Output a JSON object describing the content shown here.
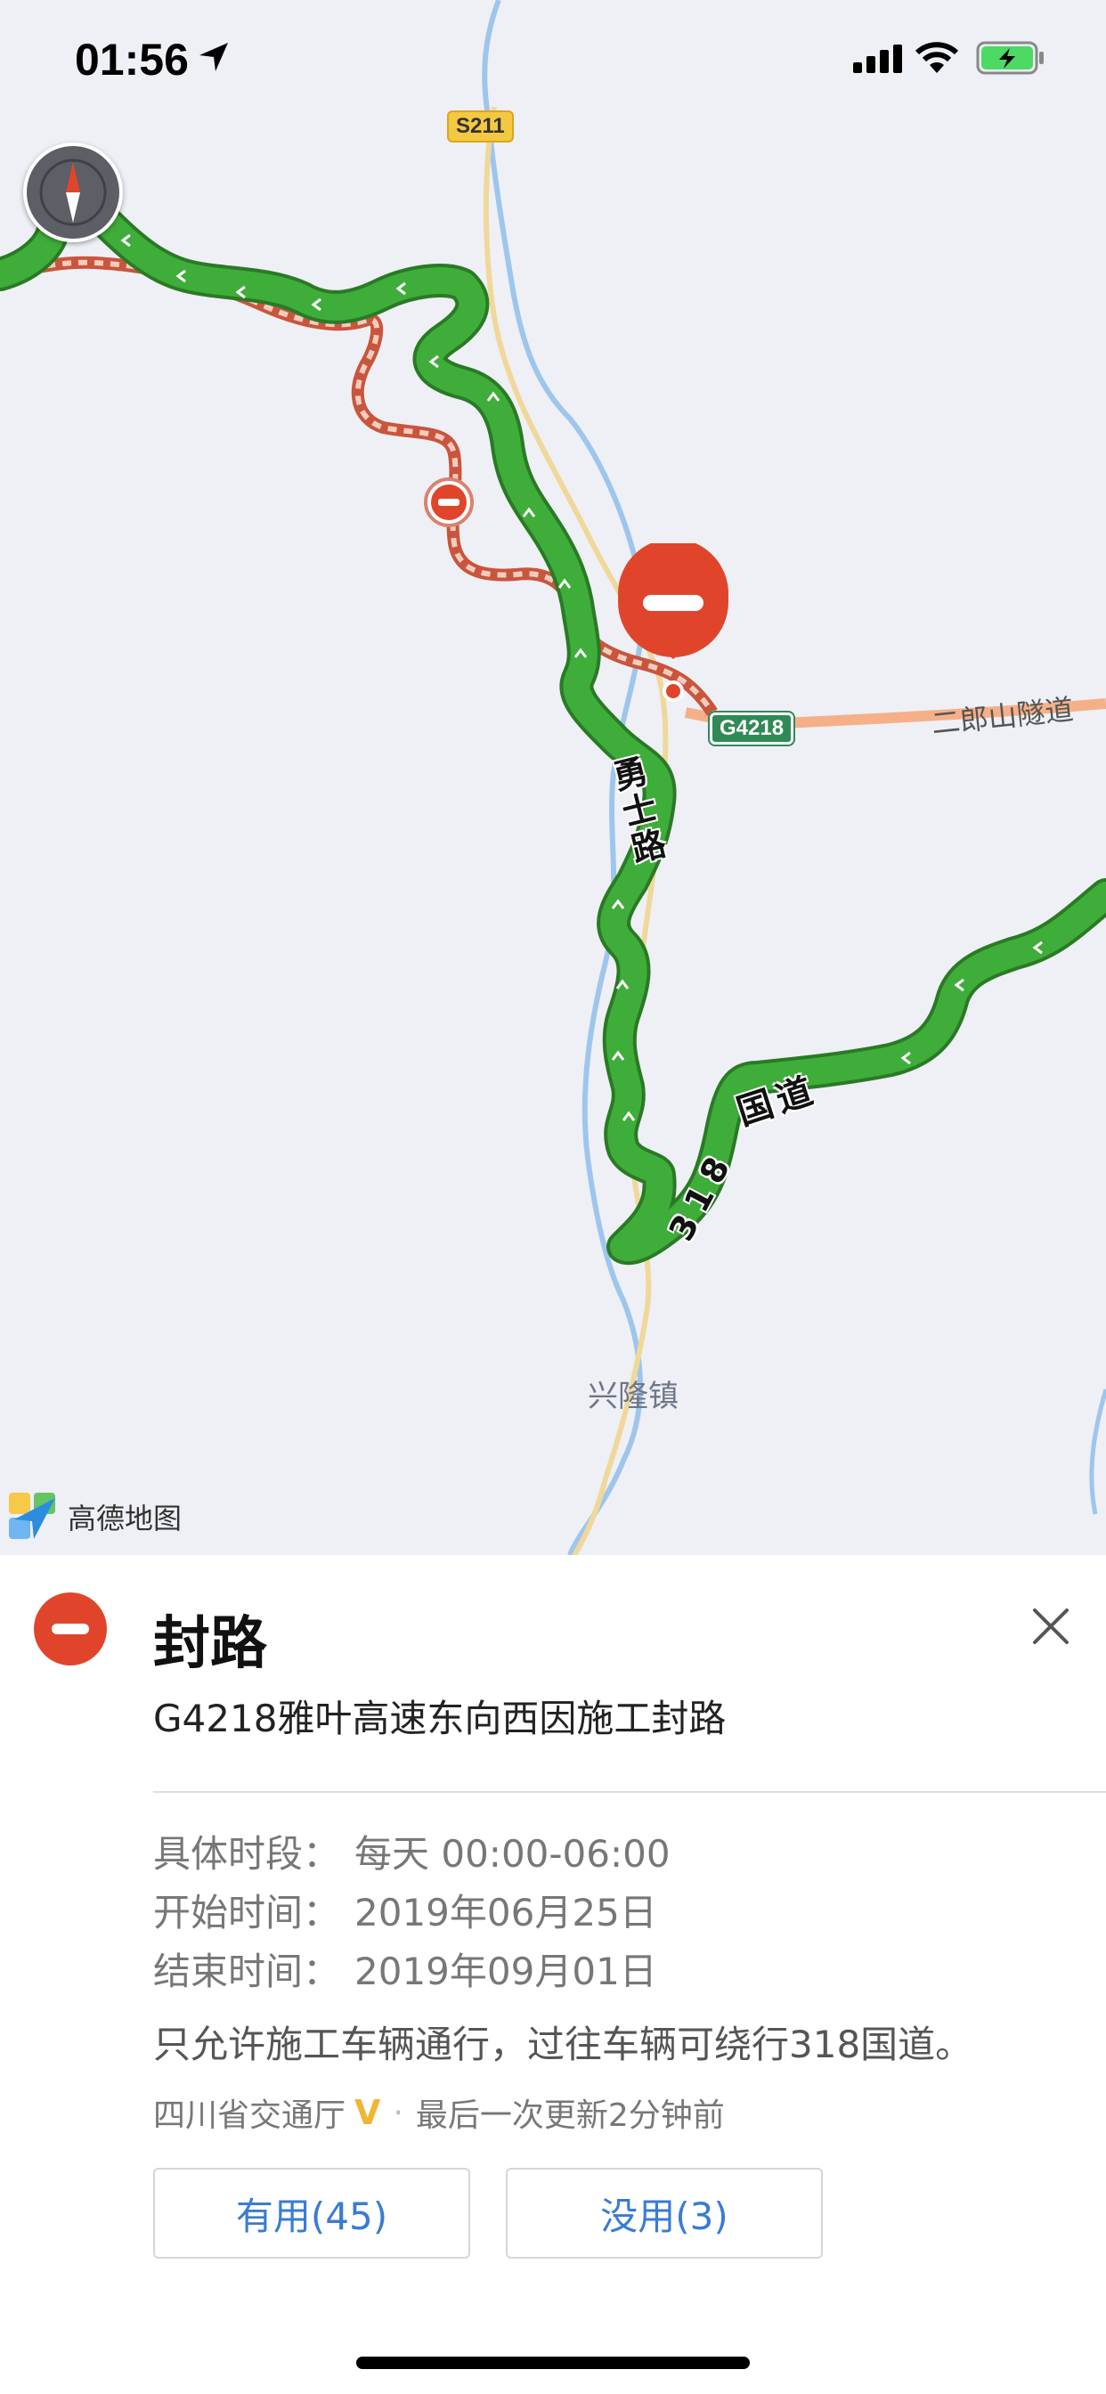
{
  "status_bar": {
    "time": "01:56",
    "icons": [
      "location-arrow-icon",
      "cellular-signal-icon",
      "wifi-icon",
      "battery-charging-icon"
    ]
  },
  "map": {
    "shield_s211": "S211",
    "shield_g4218": "G4218",
    "tunnel_label": "二郎山隧道",
    "road_yongshi": "勇士路",
    "road_318_digits": "318",
    "road_guodao": "国道",
    "town": "兴隆镇",
    "brand": "高德地图",
    "colors": {
      "route_green": "#3fad3a",
      "route_dark": "#2a7a25",
      "closure_red": "#e0452b",
      "closed_road": "#d9826f"
    }
  },
  "sheet": {
    "title": "封路",
    "subtitle": "G4218雅叶高速东向西因施工封路",
    "rows": [
      {
        "label": "具体时段：",
        "value": "每天 00:00-06:00"
      },
      {
        "label": "开始时间：",
        "value": "2019年06月25日"
      },
      {
        "label": "结束时间：",
        "value": "2019年09月01日"
      }
    ],
    "note": "只允许施工车辆通行，过往车辆可绕行318国道。",
    "source": "四川省交通厅",
    "verified_mark": "V",
    "updated": "最后一次更新2分钟前",
    "useful_button": "有用(45)",
    "useless_button": "没用(3)"
  }
}
